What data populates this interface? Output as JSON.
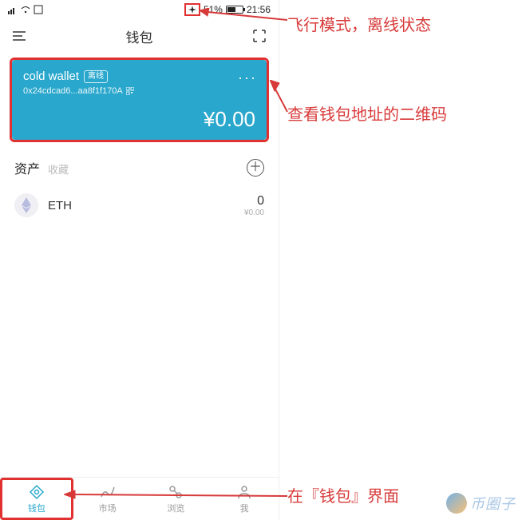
{
  "status_bar": {
    "battery_pct_text": "51%",
    "time": "21:56",
    "battery_fill_pct": 51
  },
  "header": {
    "title": "钱包"
  },
  "wallet_card": {
    "name": "cold wallet",
    "offline_badge": "离线",
    "address": "0x24cdcad6...aa8f1f170A",
    "more": "···",
    "balance": "¥0.00"
  },
  "assets": {
    "tab_assets": "资产",
    "tab_fav": "收藏",
    "items": [
      {
        "symbol": "ETH",
        "amount": "0",
        "fiat": "¥0.00"
      }
    ]
  },
  "bottom_tabs": {
    "wallet": "钱包",
    "market": "市场",
    "browse": "浏览",
    "me": "我"
  },
  "annotations": {
    "airplane": "飞行模式，离线状态",
    "qr": "查看钱包地址的二维码",
    "tab_hint": "在『钱包』界面"
  },
  "watermark": {
    "text": "币圈子"
  }
}
